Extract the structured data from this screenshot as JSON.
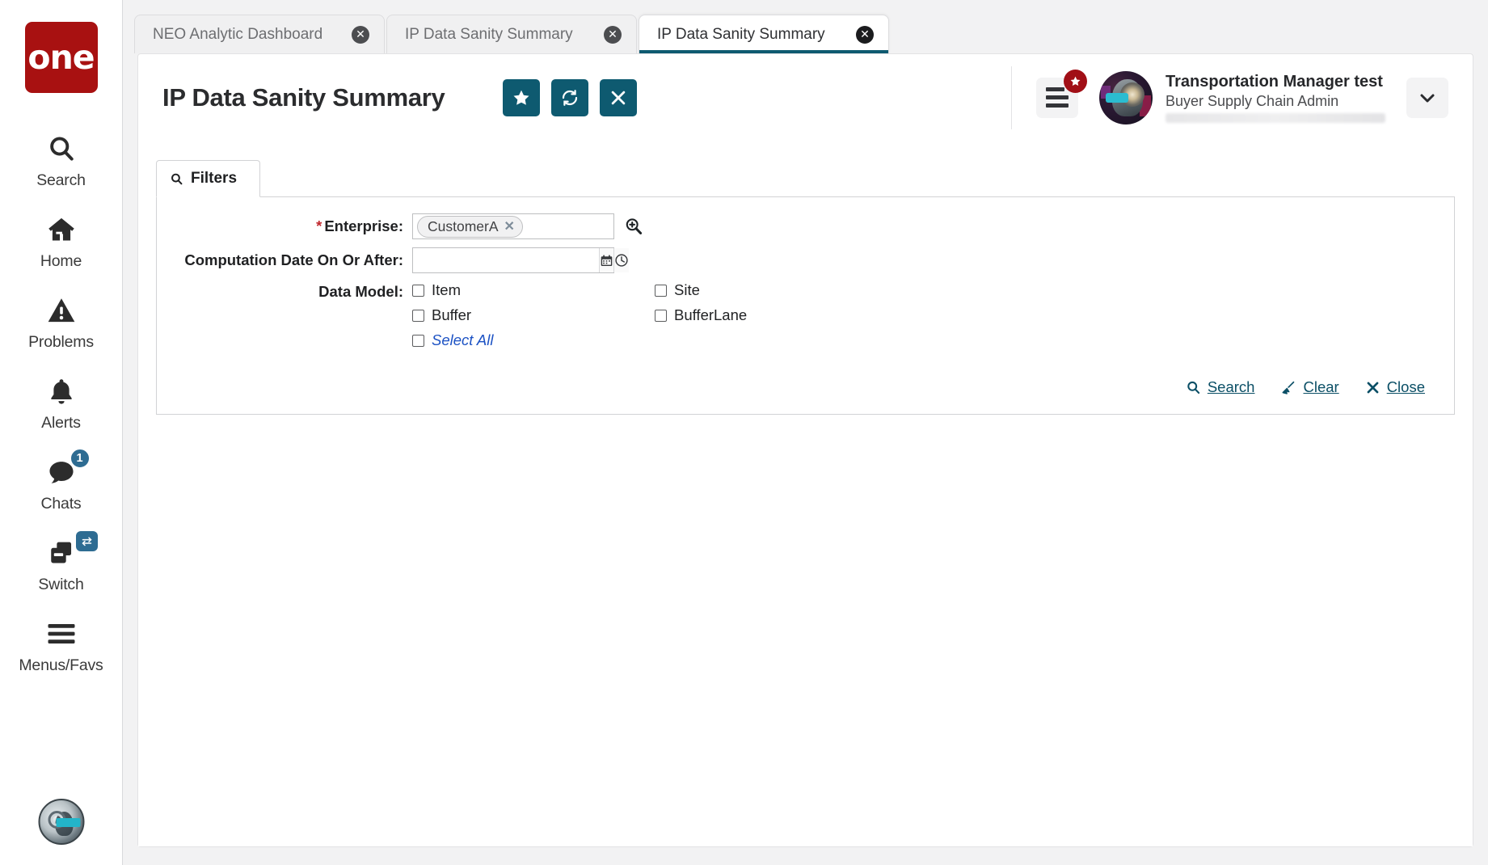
{
  "brand": {
    "logo_text": "one",
    "logo_color": "#a81111"
  },
  "theme": {
    "accent_teal": "#0e5a70",
    "badge_blue": "#2e6c92",
    "badge_red": "#a10f16",
    "link_blue": "#1c52c4"
  },
  "sidebar": {
    "items": [
      {
        "label": "Search",
        "icon": "search-icon"
      },
      {
        "label": "Home",
        "icon": "home-icon"
      },
      {
        "label": "Problems",
        "icon": "warning-triangle-icon"
      },
      {
        "label": "Alerts",
        "icon": "bell-icon"
      },
      {
        "label": "Chats",
        "icon": "chat-bubble-icon",
        "badge": "1"
      },
      {
        "label": "Switch",
        "icon": "switch-windows-icon",
        "badge_icon": "swap-arrows-icon"
      },
      {
        "label": "Menus/Favs",
        "icon": "hamburger-icon"
      }
    ],
    "assistant_avatar": "robot-assistant-avatar"
  },
  "tabs": [
    {
      "label": "NEO Analytic Dashboard",
      "active": false
    },
    {
      "label": "IP Data Sanity Summary",
      "active": false
    },
    {
      "label": "IP Data Sanity Summary",
      "active": true
    }
  ],
  "header": {
    "title": "IP Data Sanity Summary",
    "actions": [
      {
        "name": "favorite-button",
        "icon": "star-icon"
      },
      {
        "name": "refresh-button",
        "icon": "refresh-icon"
      },
      {
        "name": "close-button",
        "icon": "close-x-icon"
      }
    ],
    "menu_badge_icon": "star-icon"
  },
  "user": {
    "name": "Transportation Manager test",
    "role": "Buyer Supply Chain Admin"
  },
  "filters": {
    "tab_label": "Filters",
    "tab_icon": "search-icon",
    "enterprise": {
      "label": "Enterprise:",
      "required": true,
      "required_marker": "*",
      "chips": [
        {
          "label": "CustomerA",
          "remove_icon": "close-x-icon"
        }
      ],
      "lookup_icon": "magnifier-plus-icon"
    },
    "computation_date": {
      "label": "Computation Date On Or After:",
      "value": "",
      "placeholder": "",
      "calendar_icon": "calendar-icon",
      "clock_icon": "clock-icon"
    },
    "data_model": {
      "label": "Data Model:",
      "columns": [
        [
          {
            "label": "Item",
            "checked": false
          },
          {
            "label": "Buffer",
            "checked": false
          },
          {
            "label": "Select All",
            "checked": false,
            "style": "select-all"
          }
        ],
        [
          {
            "label": "Site",
            "checked": false
          },
          {
            "label": "BufferLane",
            "checked": false
          }
        ]
      ]
    },
    "actions": [
      {
        "label": "Search",
        "icon": "search-icon"
      },
      {
        "label": "Clear",
        "icon": "broom-icon"
      },
      {
        "label": "Close",
        "icon": "close-x-icon"
      }
    ]
  }
}
